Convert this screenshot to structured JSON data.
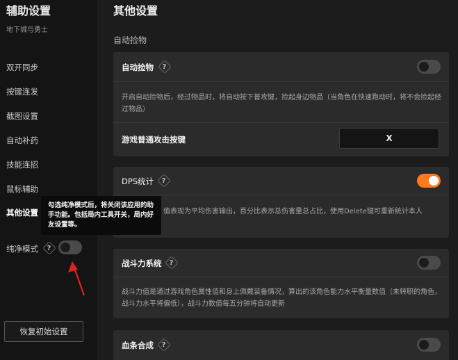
{
  "sidebar": {
    "title": "辅助设置",
    "subtitle": "地下城与勇士",
    "items": [
      {
        "label": "双开同步"
      },
      {
        "label": "按键连发"
      },
      {
        "label": "截图设置"
      },
      {
        "label": "自动补药"
      },
      {
        "label": "技能连招"
      },
      {
        "label": "鼠标辅助"
      },
      {
        "label": "其他设置"
      }
    ],
    "active_item": "其他设置",
    "pure_mode": {
      "label": "纯净模式",
      "enabled": false
    },
    "reset_label": "恢复初始设置"
  },
  "tooltip": {
    "text": "勾选纯净模式后，将关闭该应用的助手功能。包括局内工具开关，局内好友设置等。"
  },
  "main": {
    "page_title": "其他设置",
    "section_title": "自动捡物",
    "cards": [
      {
        "title": "自动捡物",
        "enabled": false,
        "desc": "开启自动捡物后，经过物品时，将自动按下普攻键，捡起身边物品（当角色在快速跑动时，将不会捡起经过物品）",
        "key_label": "游戏普通攻击按键",
        "key_value": "X"
      },
      {
        "title": "DPS统计",
        "enabled": true,
        "desc": "值表现为平均伤害输出，百分比表示总伤害量总占比，使用Delete键可重新统计本人"
      },
      {
        "title": "战斗力系统",
        "enabled": false,
        "desc": "战斗力值是通过游戏角色属性值和身上佩戴装备情况，算出的该角色能力水平衡量数值（未转职的角色，战斗力水平将偏低），战斗力数值每五分钟将自动更新"
      },
      {
        "title": "血条合成",
        "enabled": false
      }
    ]
  },
  "colors": {
    "accent": "#ff7a1f",
    "annotation_arrow": "#e02020"
  }
}
